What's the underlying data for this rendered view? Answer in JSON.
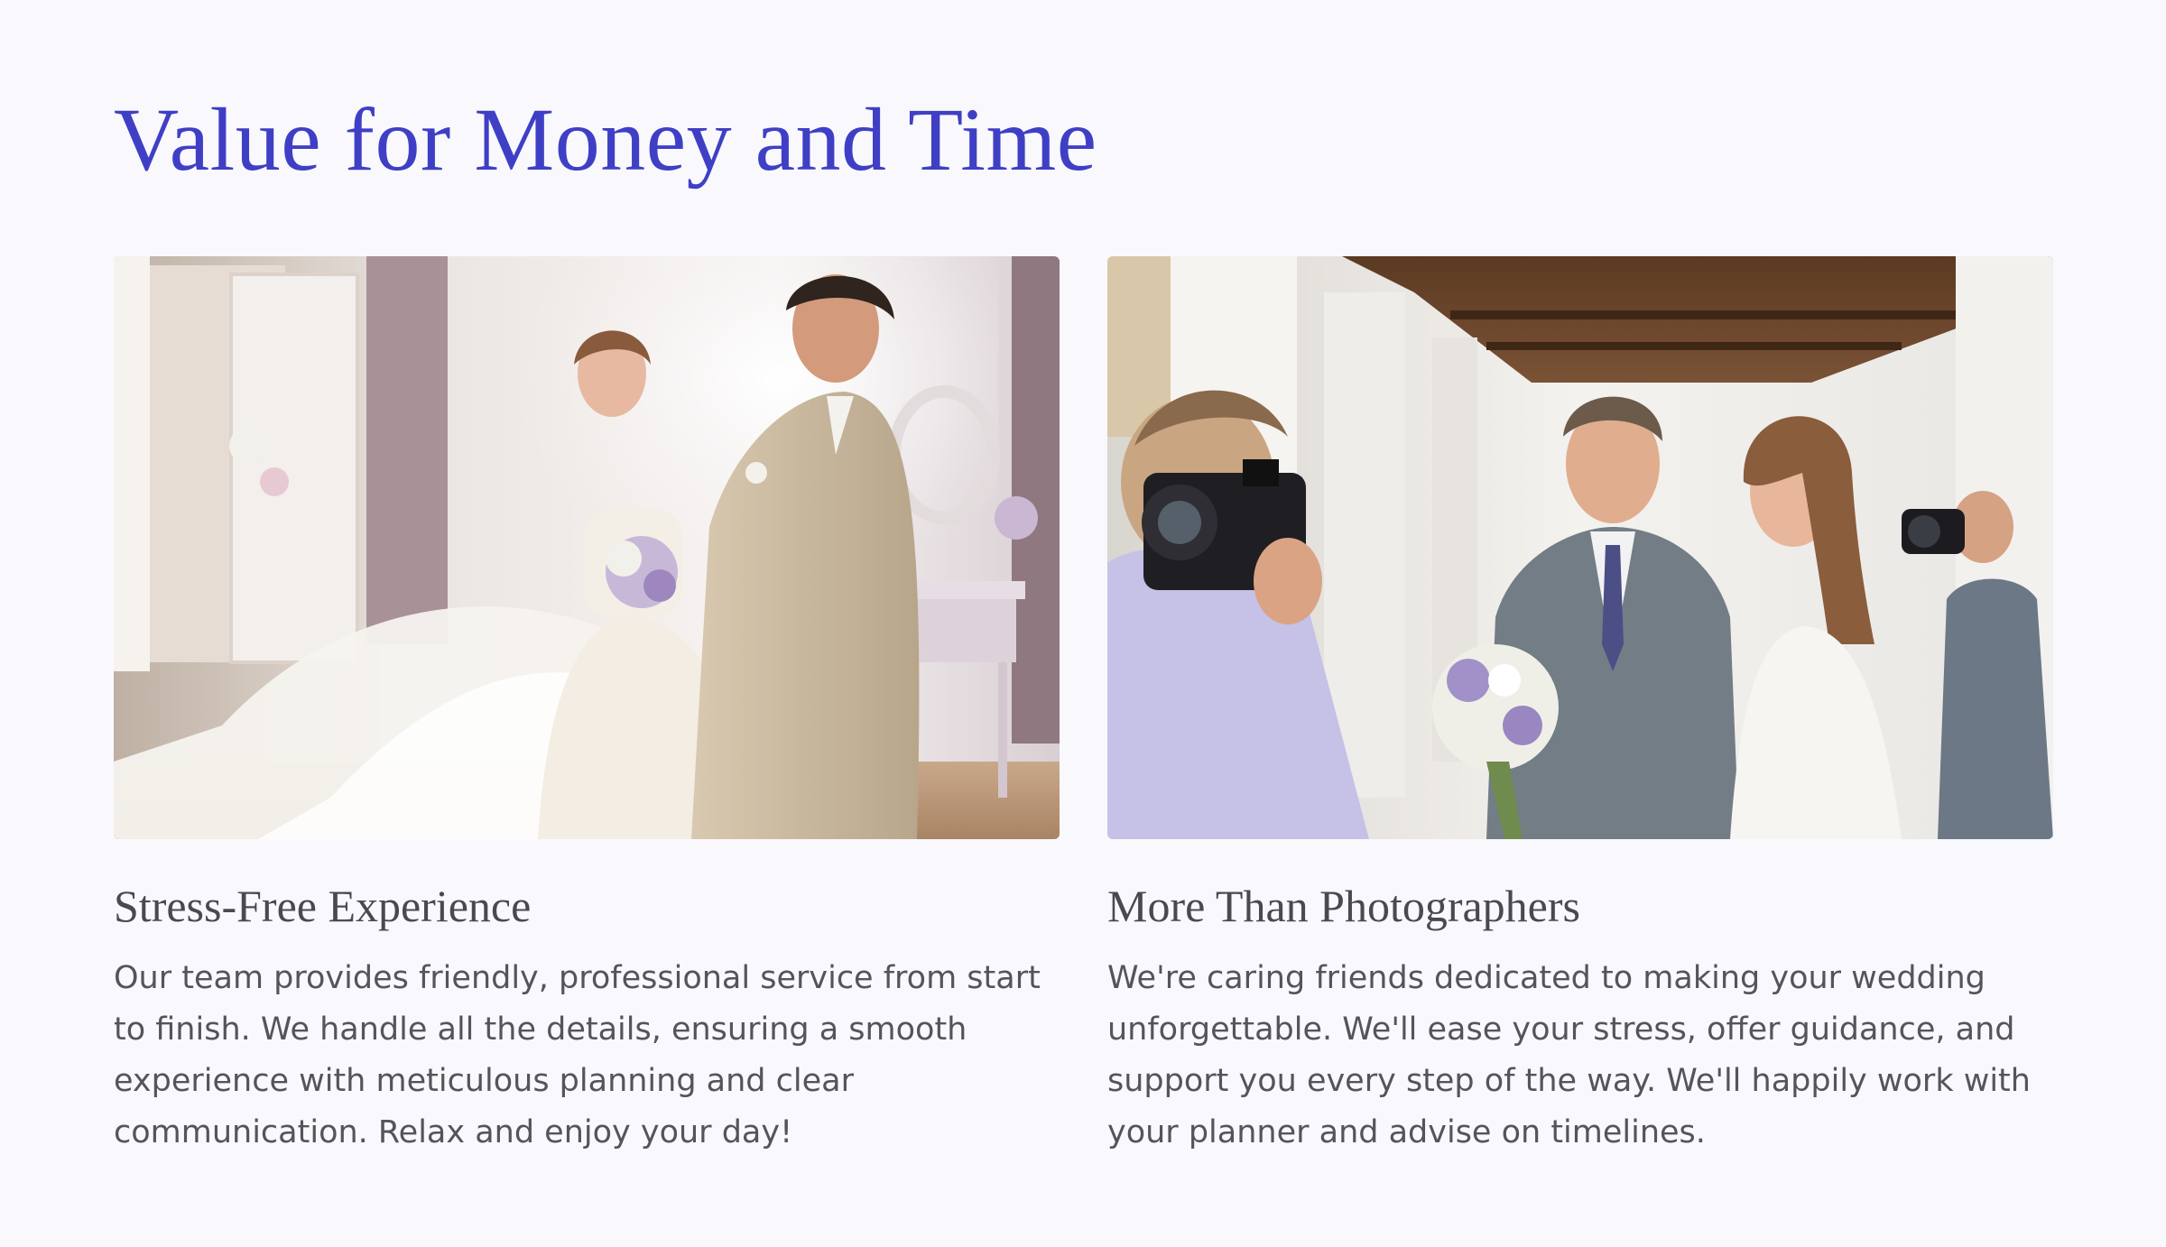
{
  "header": {
    "title": "Value for Money and Time"
  },
  "cards": [
    {
      "title": "Stress-Free Experience",
      "body": "Our team provides friendly, professional service from start to finish. We handle all the details, ensuring a smooth experience with meticulous planning and clear communication. Relax and enjoy your day!",
      "image": "bride-and-groom-in-bridal-suite-photo"
    },
    {
      "title": "More Than Photographers",
      "body": "We're caring friends dedicated to making your wedding unforgettable. We'll ease your stress, offer guidance, and support you every step of the way. We'll happily work with your planner and advise on timelines.",
      "image": "photographers-capturing-couple-photo"
    }
  ],
  "colors": {
    "page_background": "#f9f9fd",
    "title_accent": "#3f3fc6",
    "card_title": "#4a4950",
    "body_text": "#55545b"
  }
}
